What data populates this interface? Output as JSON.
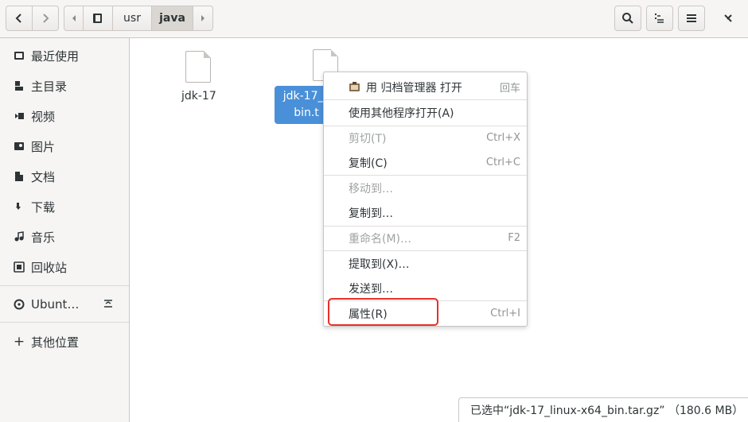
{
  "path": {
    "segments": [
      "usr",
      "java"
    ],
    "active": "java"
  },
  "sidebar": {
    "items": [
      {
        "label": "最近使用",
        "icon": "clock-icon"
      },
      {
        "label": "主目录",
        "icon": "home-icon"
      },
      {
        "label": "视频",
        "icon": "video-icon"
      },
      {
        "label": "图片",
        "icon": "image-icon"
      },
      {
        "label": "文档",
        "icon": "document-icon"
      },
      {
        "label": "下载",
        "icon": "download-icon"
      },
      {
        "label": "音乐",
        "icon": "music-icon"
      },
      {
        "label": "回收站",
        "icon": "trash-icon"
      }
    ],
    "drive": {
      "label": "Ubunt…",
      "icon": "disc-icon",
      "eject_icon": "eject-icon"
    },
    "other": {
      "label": "其他位置",
      "icon": "plus-icon"
    }
  },
  "files": [
    {
      "name": "jdk-17",
      "selected": false
    },
    {
      "name_line1": "jdk-17_li",
      "name_line2": "bin.t",
      "selected": true
    }
  ],
  "context_menu": {
    "items": [
      {
        "label": "用 归档管理器 打开",
        "accel": "回车",
        "enabled": true,
        "icon": "archive-manager-icon"
      },
      {
        "label": "使用其他程序打开(A)",
        "accel": "",
        "enabled": true
      },
      {
        "label": "剪切(T)",
        "accel": "Ctrl+X",
        "enabled": false
      },
      {
        "label": "复制(C)",
        "accel": "Ctrl+C",
        "enabled": true
      },
      {
        "label": "移动到…",
        "accel": "",
        "enabled": false
      },
      {
        "label": "复制到…",
        "accel": "",
        "enabled": true
      },
      {
        "label": "重命名(M)…",
        "accel": "F2",
        "enabled": false
      },
      {
        "label": "提取到(X)…",
        "accel": "",
        "enabled": true
      },
      {
        "label": "发送到…",
        "accel": "",
        "enabled": true
      },
      {
        "label": "属性(R)",
        "accel": "Ctrl+I",
        "enabled": true,
        "highlighted": true
      }
    ]
  },
  "status": {
    "text": "已选中“jdk-17_linux-x64_bin.tar.gz” （180.6 MB）"
  },
  "colors": {
    "selection": "#4a90d9",
    "highlight_box": "#e8302a"
  }
}
